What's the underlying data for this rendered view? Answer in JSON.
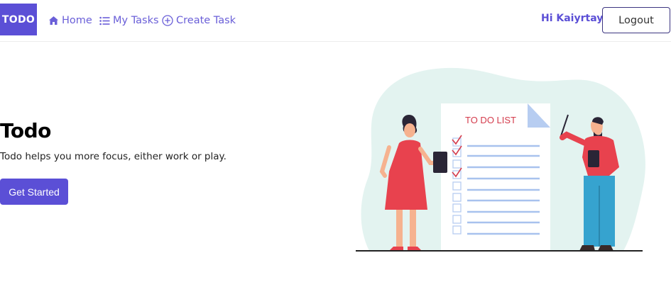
{
  "navbar": {
    "brand": "TODO",
    "links": [
      {
        "label": "Home",
        "icon": "home-icon"
      },
      {
        "label": "My Tasks",
        "icon": "list-icon"
      },
      {
        "label": "Create Task",
        "icon": "plus-circle-icon"
      }
    ],
    "greeting": "Hi Kaiyrtay",
    "logout_label": "Logout"
  },
  "hero": {
    "title": "Todo",
    "subtitle": "Todo helps you more focus, either work or play.",
    "cta_label": "Get Started",
    "illustration": {
      "list_title": "TO DO LIST"
    }
  },
  "colors": {
    "accent": "#5b4fd6",
    "link": "#6a5fd8",
    "checkmark": "#d43b4c",
    "blob": "#e3f3f0"
  }
}
